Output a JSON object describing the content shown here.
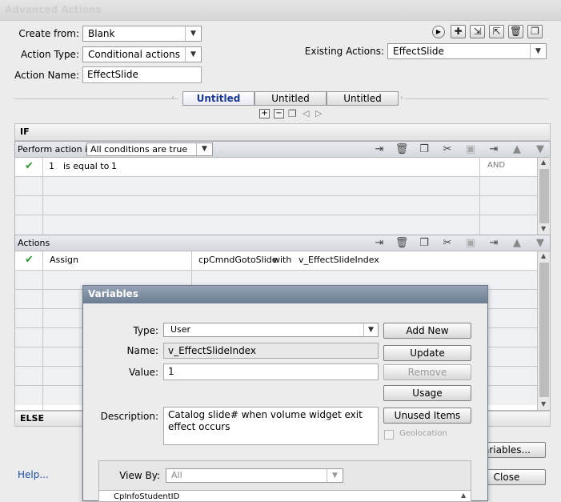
{
  "window": {
    "title": "Advanced Actions"
  },
  "form": {
    "create_from_label": "Create from:",
    "create_from_value": "Blank",
    "action_type_label": "Action Type:",
    "action_type_value": "Conditional actions",
    "action_name_label": "Action Name:",
    "action_name_value": "EffectSlide",
    "existing_actions_label": "Existing Actions:",
    "existing_actions_value": "EffectSlide"
  },
  "tabs": [
    "Untitled",
    "Untitled",
    "Untitled"
  ],
  "if_section": {
    "title": "IF",
    "perform_label": "Perform action if:",
    "perform_value": "All conditions are true",
    "condition": {
      "operand1": "1",
      "operator": "is equal to",
      "operand2": "1",
      "logic": "AND"
    }
  },
  "actions_section": {
    "title": "Actions",
    "action": {
      "command": "Assign",
      "target": "cpCmndGotoSlide",
      "with": "with",
      "source": "v_EffectSlideIndex"
    }
  },
  "else_section": {
    "title": "ELSE"
  },
  "bottom": {
    "help": "Help...",
    "variables_button": "Variables...",
    "close_button": "Close"
  },
  "variables_dialog": {
    "title": "Variables",
    "type_label": "Type:",
    "type_value": "User",
    "name_label": "Name:",
    "name_value": "v_EffectSlideIndex",
    "value_label": "Value:",
    "value_value": "1",
    "description_label": "Description:",
    "description_value": "Catalog slide# when volume widget exit effect occurs",
    "add_new": "Add New",
    "update": "Update",
    "remove": "Remove",
    "usage": "Usage",
    "unused_items": "Unused Items",
    "geolocation": "Geolocation",
    "view_by_label": "View By:",
    "view_by_value": "All",
    "list_partial_item": "CpInfoStudentID"
  }
}
